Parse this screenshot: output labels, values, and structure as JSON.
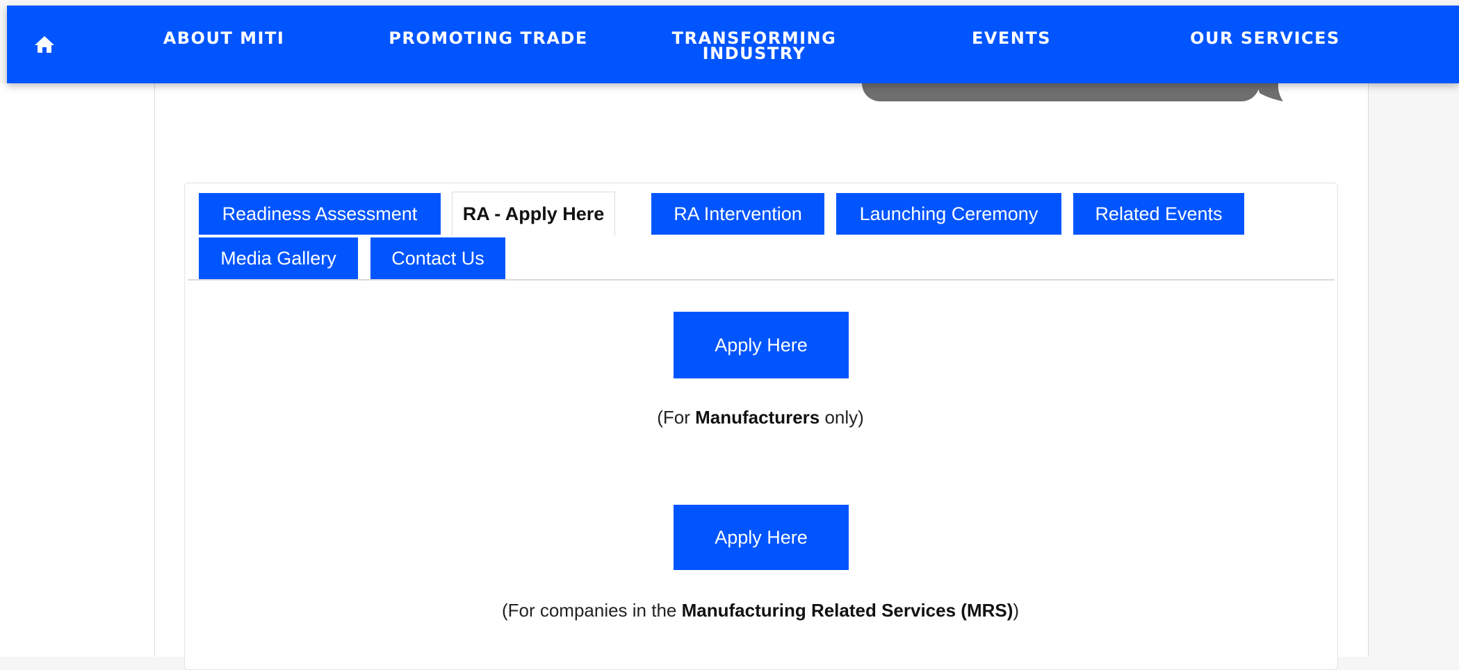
{
  "nav": {
    "home_icon": "home-icon",
    "items": [
      {
        "label": "ABOUT MITI"
      },
      {
        "label": "PROMOTING TRADE"
      },
      {
        "label_line1": "TRANSFORMING",
        "label_line2": "INDUSTRY"
      },
      {
        "label": "EVENTS"
      },
      {
        "label": "OUR SERVICES"
      }
    ]
  },
  "tabs": {
    "active_tab": "RA - Apply Here",
    "items": [
      {
        "label": "Readiness Assessment"
      },
      {
        "label": "RA - Apply Here"
      },
      {
        "label": "RA Intervention"
      },
      {
        "label": "Launching Ceremony"
      },
      {
        "label": "Related Events"
      },
      {
        "label": "Media Gallery"
      },
      {
        "label": "Contact Us"
      }
    ]
  },
  "apply_sections": [
    {
      "button_label": "Apply Here",
      "note_prefix": "(For ",
      "note_bold": "Manufacturers",
      "note_suffix": " only)"
    },
    {
      "button_label": "Apply Here",
      "note_prefix": "(For companies in the ",
      "note_bold": "Manufacturing Related Services (MRS)",
      "note_suffix": ")"
    }
  ],
  "colors": {
    "brand_blue": "#0055ff",
    "tab_active_bg": "#ffffff",
    "decorative_gray": "#6f6f6f"
  }
}
